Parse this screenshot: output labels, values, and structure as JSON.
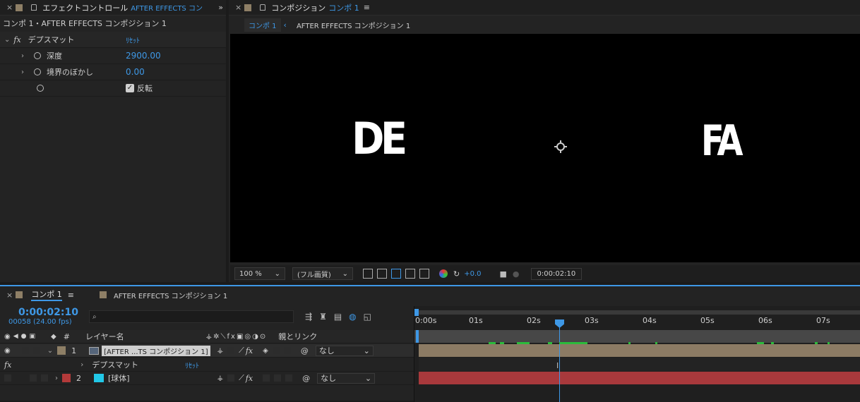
{
  "effect_panel": {
    "tab_title": "エフェクトコントロール",
    "tab_layer": "AFTER EFFECTS コン",
    "breadcrumb": "コンポ 1・AFTER EFFECTS コンポジション 1",
    "effect_name": "デプスマット",
    "reset_label": "ﾘｾｯﾄ",
    "properties": [
      {
        "name": "深度",
        "value": "2900.00"
      },
      {
        "name": "境界のぼかし",
        "value": "0.00"
      },
      {
        "name": "",
        "value": "反転",
        "checked": true
      }
    ]
  },
  "comp_panel": {
    "tab_title": "コンポジション",
    "tab_comp": "コンポ 1",
    "menu_glyph": "≡",
    "nav_current": "コンポ 1",
    "nav_child": "AFTER EFFECTS コンポジション 1",
    "zoom": "100 %",
    "quality": "(フル画質)",
    "exposure": "+0.0",
    "timecode": "0:00:02:10",
    "viewer_text_left": "DE",
    "viewer_text_right": "FA"
  },
  "timeline": {
    "tab_comp": "コンポ 1",
    "tab_other": "AFTER EFFECTS コンポジション 1",
    "timecode": "0:00:02:10",
    "frame_info": "00058 (24.00 fps)",
    "search_placeholder": "",
    "col_layer_name": "レイヤー名",
    "col_num": "#",
    "col_parent": "親とリンク",
    "ruler": [
      "0:00s",
      "01s",
      "02s",
      "03s",
      "04s",
      "05s",
      "06s",
      "07s"
    ],
    "layers": [
      {
        "num": "1",
        "name": "[AFTER ...TS コンポジション 1]",
        "parent": "なし",
        "color": "#8e7f66",
        "effect": "デプスマット",
        "reset": "ﾘｾｯﾄ"
      },
      {
        "num": "2",
        "name": "[球体]",
        "parent": "なし",
        "color": "#b33a3a"
      }
    ],
    "fx_label": "fx",
    "colors": {
      "layer1_bar": "#8e7f66",
      "layer2_bar": "#a8393c",
      "accent": "#3e98e6"
    }
  }
}
